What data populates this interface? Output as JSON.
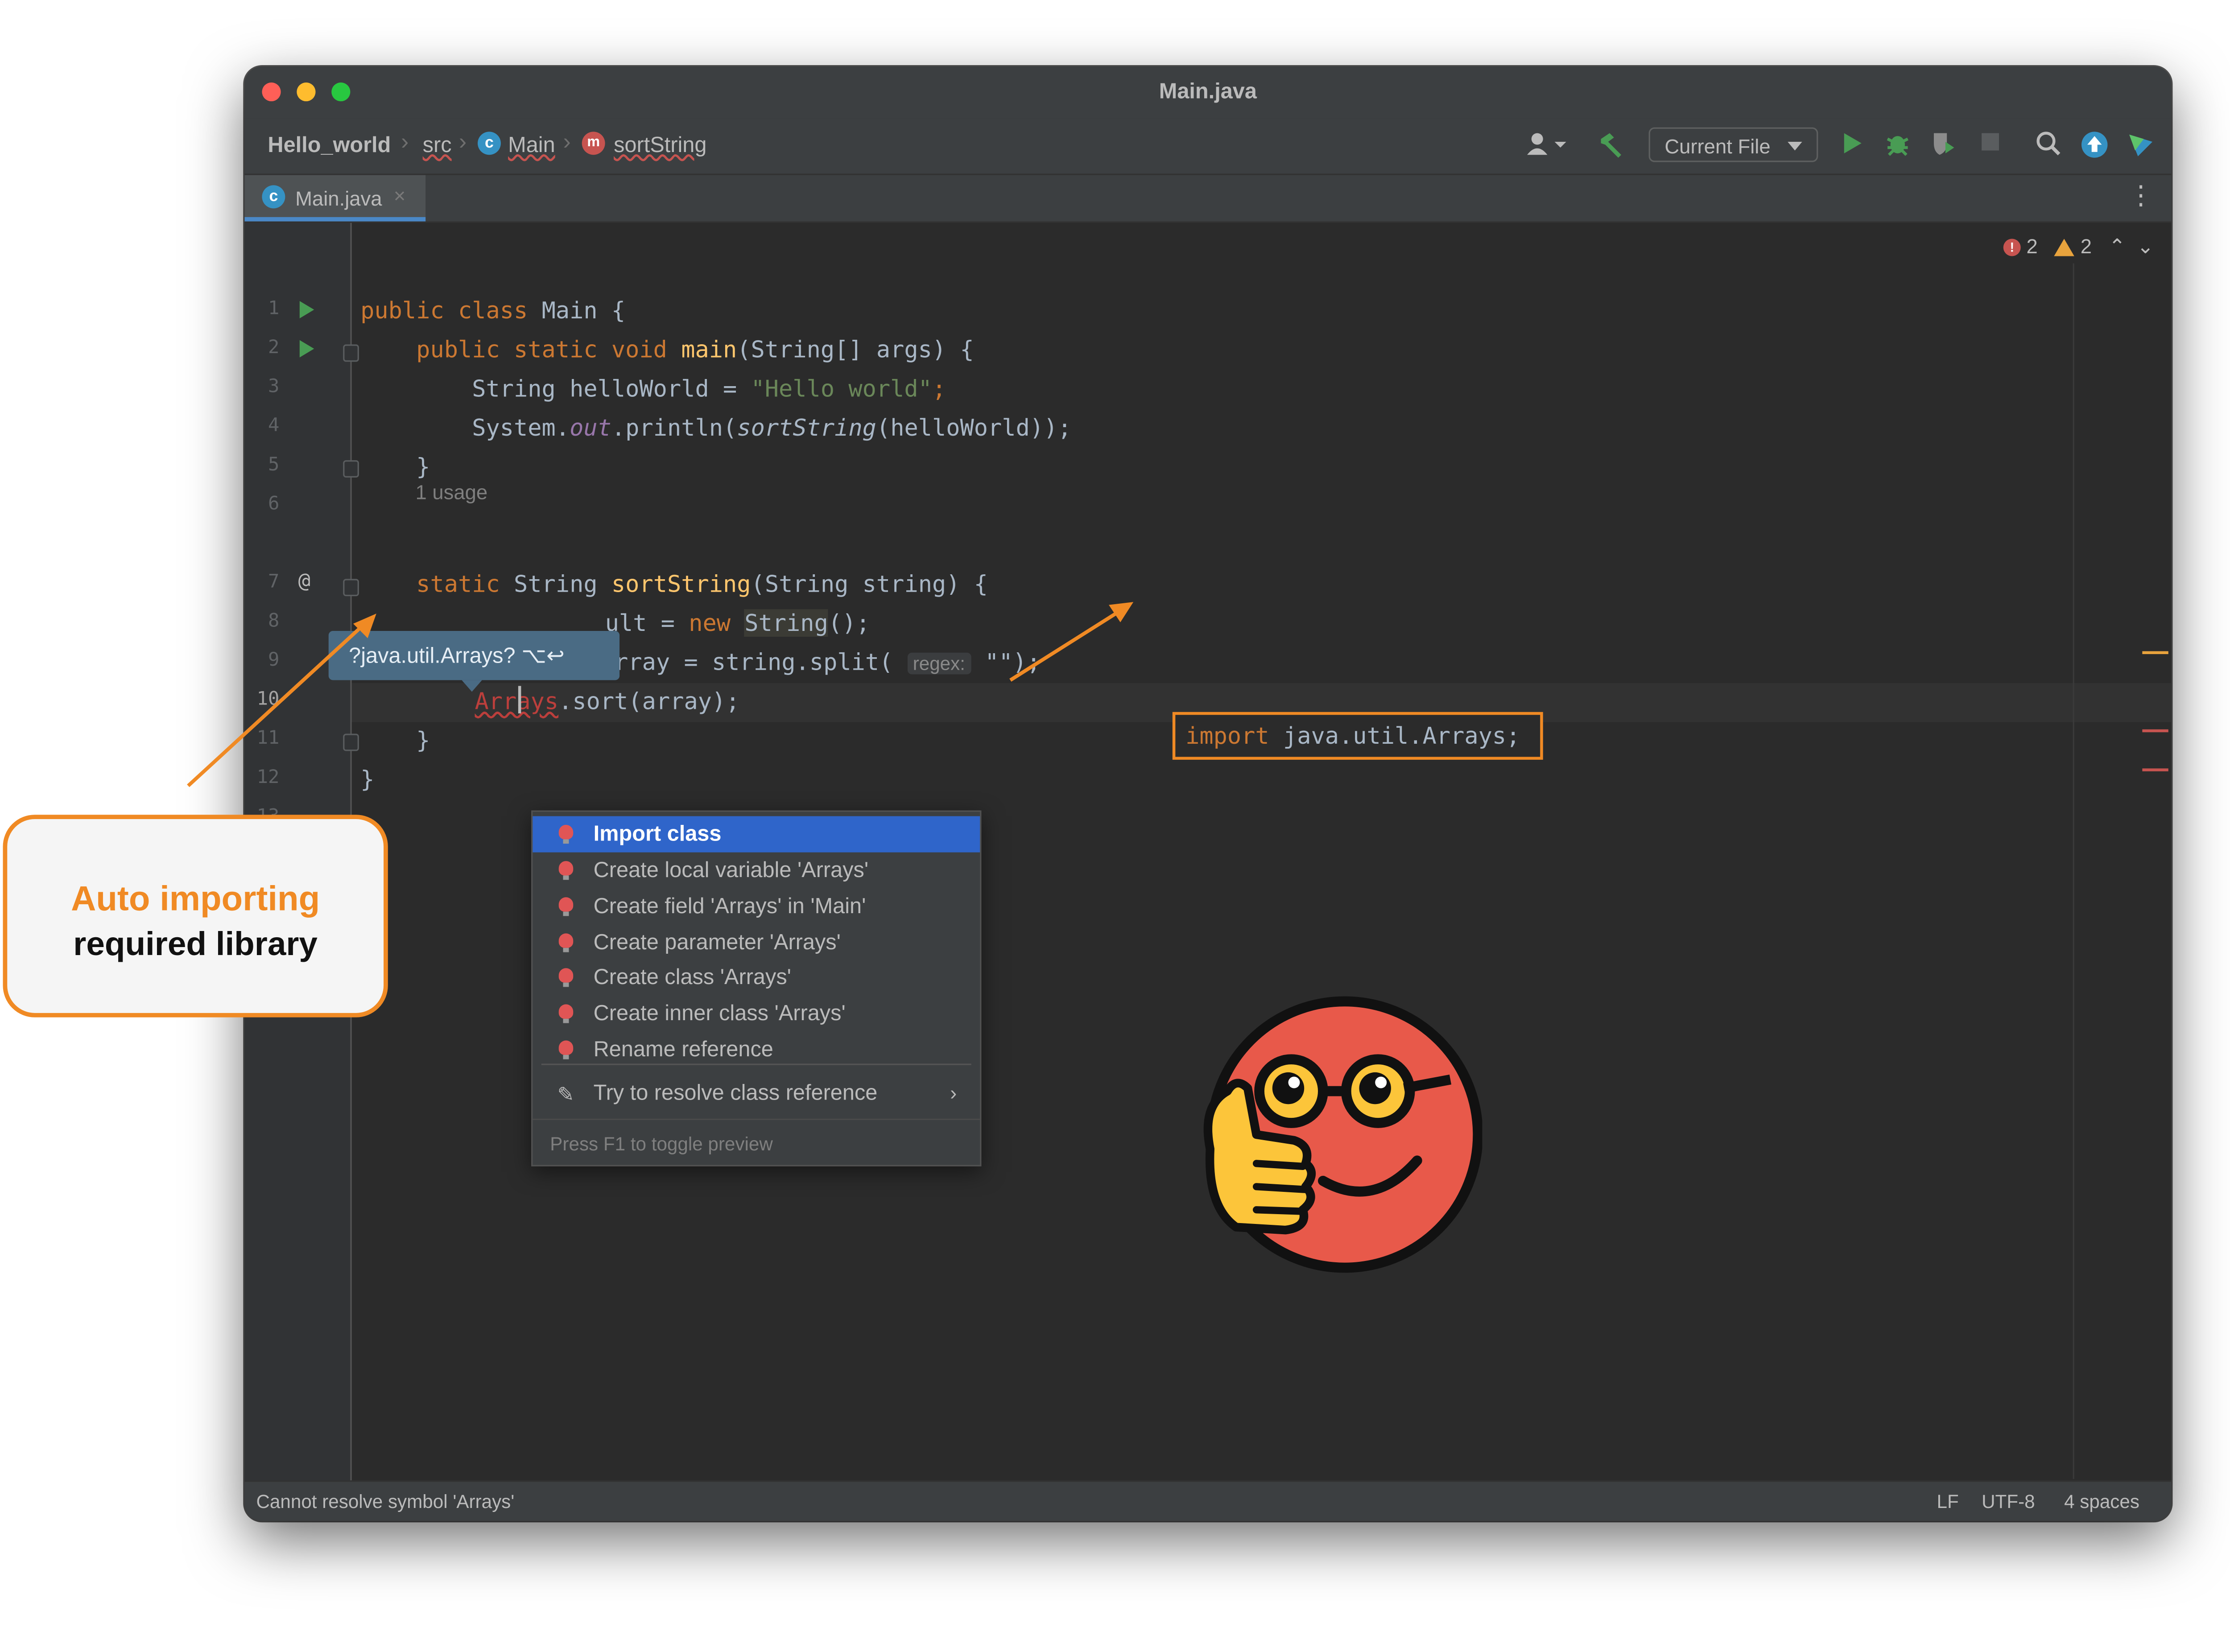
{
  "window": {
    "title": "Main.java"
  },
  "breadcrumb": {
    "project": "Hello_world",
    "folder": "src",
    "class": "Main",
    "method": "sortString"
  },
  "toolbar": {
    "run_config": "Current File",
    "icons": [
      "profile-icon",
      "build-hammer-icon",
      "run-icon",
      "debug-bug-icon",
      "coverage-icon",
      "stop-icon",
      "search-icon",
      "update-icon",
      "toolbox-icon"
    ]
  },
  "tab": {
    "label": "Main.java"
  },
  "inspections": {
    "errors": "2",
    "warnings": "2"
  },
  "gutter": {
    "line_numbers": [
      "1",
      "2",
      "3",
      "4",
      "5",
      "6",
      "7",
      "8",
      "9",
      "10",
      "11",
      "12",
      "13"
    ]
  },
  "code": {
    "usage_hint": "1 usage",
    "line1": [
      "public class ",
      "Main {"
    ],
    "line2": [
      "    public static void ",
      "main",
      "(String[] args) {"
    ],
    "line3": [
      "        String helloWorld = ",
      "\"Hello world\"",
      ";"
    ],
    "line4": [
      "        System.",
      "out",
      ".println(",
      "sortString",
      "(helloWorld));"
    ],
    "line5": "    }",
    "line7": [
      "    static ",
      "String ",
      "sortString",
      "(String string) {"
    ],
    "line8": [
      "ult = ",
      "new ",
      "String",
      "();"
    ],
    "line9": [
      "String[] array = string.split( ",
      "regex:",
      " \"\");"
    ],
    "line10": [
      "Arrays",
      ".sort(array);"
    ],
    "line11": "    }",
    "line12": "}"
  },
  "tooltip": {
    "text": "?java.util.Arrays? ⌥↩"
  },
  "intention_popup": {
    "items": [
      "Import class",
      "Create local variable 'Arrays'",
      "Create field 'Arrays' in 'Main'",
      "Create parameter 'Arrays'",
      "Create class 'Arrays'",
      "Create inner class 'Arrays'",
      "Rename reference"
    ],
    "resolve": "Try to resolve class reference",
    "footer": "Press F1 to toggle preview"
  },
  "import_preview": {
    "keyword": "import ",
    "statement": "java.util.Arrays;"
  },
  "statusbar": {
    "message": "Cannot resolve symbol 'Arrays'",
    "line_sep": "LF",
    "encoding": "UTF-8",
    "indent": "4 spaces"
  },
  "callout": {
    "line1": "Auto importing",
    "line2": "required library"
  },
  "colors": {
    "accent": "#f08a24",
    "selection": "#2f65ca",
    "editor_bg": "#2b2b2b",
    "error": "#c75450"
  }
}
